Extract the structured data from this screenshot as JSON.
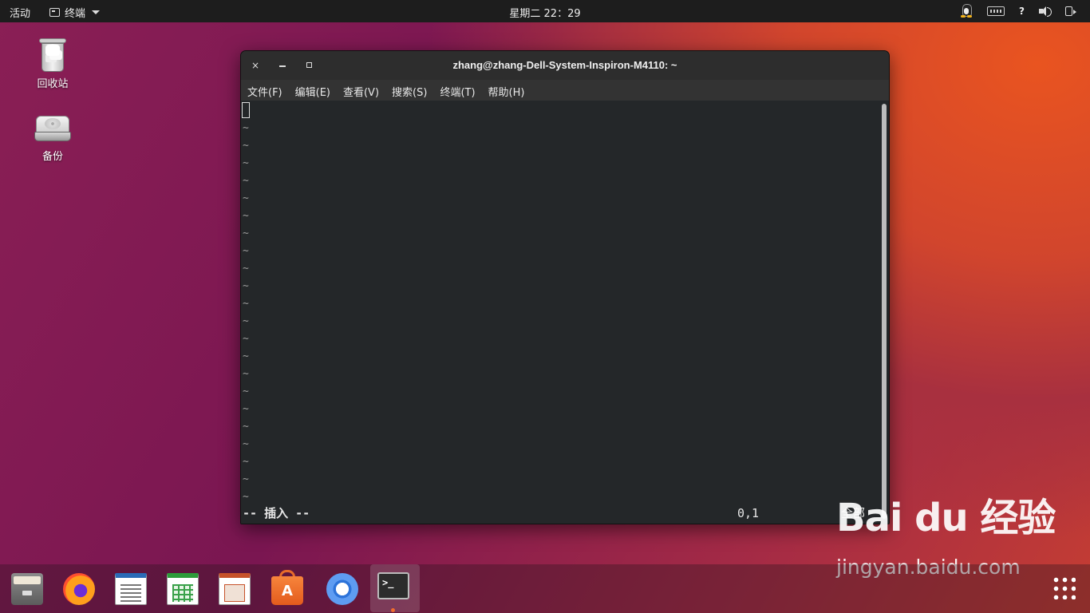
{
  "topbar": {
    "activities": "活动",
    "app_name": "终端",
    "clock": "星期二 22：29",
    "help": "?"
  },
  "desktop": {
    "icons": [
      {
        "label": "回收站",
        "icon": "trash-icon"
      },
      {
        "label": "备份",
        "icon": "drive-icon"
      }
    ]
  },
  "terminal": {
    "title": "zhang@zhang-Dell-System-Inspiron-M4110: ~",
    "window_buttons": {
      "close": "×"
    },
    "menus": [
      "文件(F)",
      "编辑(E)",
      "查看(V)",
      "搜索(S)",
      "终端(T)",
      "帮助(H)"
    ],
    "tilde": "~",
    "tilde_rows": 22,
    "status": {
      "mode": "-- 插入 --",
      "position": "0,1",
      "scroll": "全部"
    }
  },
  "dock": {
    "items": [
      "files-icon",
      "firefox-icon",
      "libreoffice-writer-icon",
      "libreoffice-calc-icon",
      "libreoffice-impress-icon",
      "software-store-icon",
      "chromium-icon",
      "terminal-icon"
    ],
    "store_glyph": "A",
    "active": "terminal-icon"
  },
  "watermark": {
    "brand": "Bai du 经验",
    "url": "jingyan.baidu.com"
  },
  "colors": {
    "accent": "#e95420",
    "terminal_bg": "#242729",
    "topbar_bg": "#1d1d1d"
  }
}
